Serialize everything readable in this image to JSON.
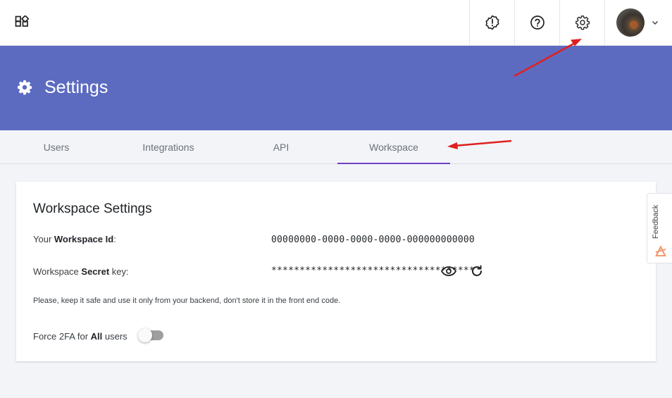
{
  "header": {
    "title": "Settings"
  },
  "tabs": [
    {
      "label": "Users"
    },
    {
      "label": "Integrations"
    },
    {
      "label": "API"
    },
    {
      "label": "Workspace",
      "active": true
    }
  ],
  "card": {
    "title": "Workspace Settings",
    "workspace_id": {
      "label_prefix": "Your ",
      "label_bold": "Workspace Id",
      "label_suffix": ":",
      "value": "00000000-0000-0000-0000-000000000000"
    },
    "secret": {
      "label_prefix": "Workspace ",
      "label_bold": "Secret",
      "label_suffix": " key:",
      "value": "************************************"
    },
    "hint": "Please, keep it safe and use it only from your backend, don't store it in the front end code.",
    "force2fa": {
      "label_prefix": "Force 2FA for ",
      "label_bold": "All",
      "label_suffix": " users",
      "enabled": false
    }
  },
  "feedback": {
    "label": "Feedback"
  },
  "icons": {
    "apps": "apps-icon",
    "alert": "alert-badge-icon",
    "help": "help-icon",
    "settings": "gear-icon",
    "user_menu": "chevron-down-icon",
    "reveal": "eye-icon",
    "regenerate": "refresh-icon"
  },
  "colors": {
    "header_band": "#5c6bc0",
    "active_tab_underline": "#6f42c1",
    "annotation_arrow": "#e02020",
    "page_background": "#f2f4f8"
  }
}
